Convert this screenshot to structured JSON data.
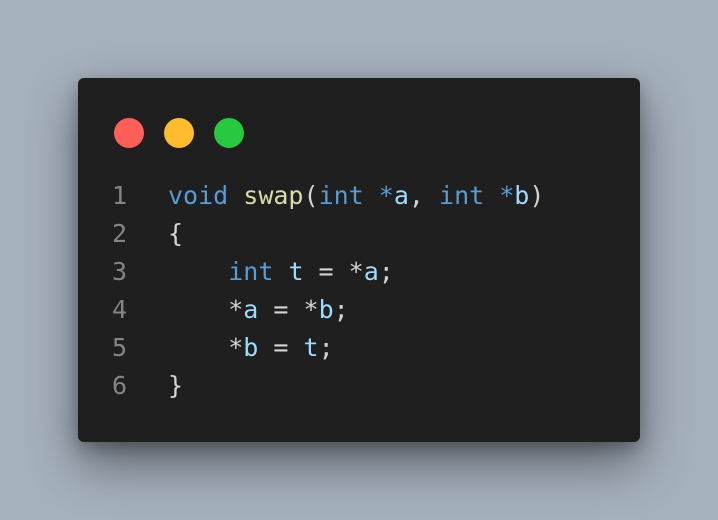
{
  "window_controls": {
    "close_color": "#ff5f57",
    "minimize_color": "#febc2e",
    "maximize_color": "#28c840"
  },
  "colors": {
    "background": "#a6b1be",
    "editor": "#1f1f1f",
    "keyword": "#569cd6",
    "function": "#dcdcaa",
    "variable": "#9cdcfe",
    "punctuation": "#d4d4d4",
    "line_number": "#858585"
  },
  "code": {
    "line_numbers": [
      "1",
      "2",
      "3",
      "4",
      "5",
      "6"
    ],
    "line1": {
      "kw_void": "void",
      "sp1": " ",
      "fn_name": "swap",
      "open_paren": "(",
      "kw_int1": "int",
      "sp2": " ",
      "star1": "*",
      "var_a": "a",
      "comma": ", ",
      "kw_int2": "int",
      "sp3": " ",
      "star2": "*",
      "var_b": "b",
      "close_paren": ")"
    },
    "line2": {
      "brace": "{"
    },
    "line3": {
      "indent": "    ",
      "kw_int": "int",
      "sp": " ",
      "var_t": "t",
      "assign": " = ",
      "star": "*",
      "var_a": "a",
      "semi": ";"
    },
    "line4": {
      "indent": "    ",
      "star1": "*",
      "var_a": "a",
      "assign": " = ",
      "star2": "*",
      "var_b": "b",
      "semi": ";"
    },
    "line5": {
      "indent": "    ",
      "star": "*",
      "var_b": "b",
      "assign": " = ",
      "var_t": "t",
      "semi": ";"
    },
    "line6": {
      "brace": "}"
    }
  }
}
